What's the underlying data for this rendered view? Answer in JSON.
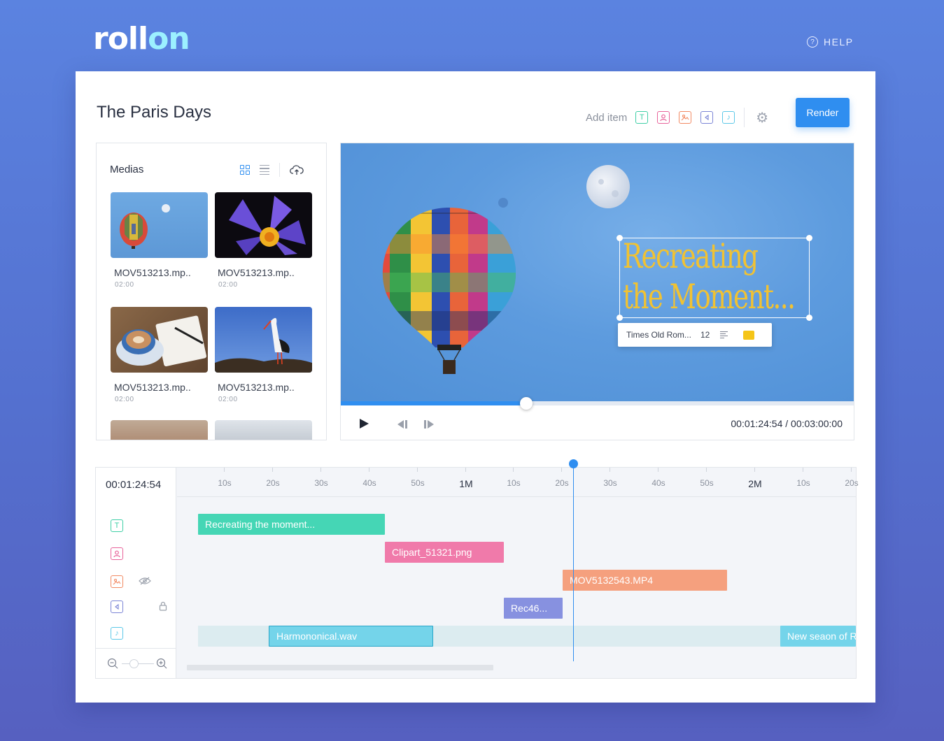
{
  "app": {
    "logo_main": "roll",
    "logo_accent": "on",
    "help_label": "HELP",
    "help_icon": "question-circle-icon"
  },
  "project": {
    "title": "The Paris Days"
  },
  "toolbar": {
    "add_item_label": "Add item",
    "add_items": [
      {
        "icon": "text-icon",
        "glyph": "T"
      },
      {
        "icon": "clipart-icon",
        "glyph": ""
      },
      {
        "icon": "image-icon",
        "glyph": ""
      },
      {
        "icon": "record-icon",
        "glyph": ""
      },
      {
        "icon": "music-icon",
        "glyph": "♪"
      }
    ],
    "settings_icon": "gear-icon",
    "render_label": "Render"
  },
  "medias": {
    "title": "Medias",
    "view_mode": "grid",
    "items": [
      {
        "name": "MOV513213.mp..",
        "duration": "02:00",
        "subject": "balloon"
      },
      {
        "name": "MOV513213.mp..",
        "duration": "02:00",
        "subject": "flower"
      },
      {
        "name": "MOV513213.mp..",
        "duration": "02:00",
        "subject": "coffee"
      },
      {
        "name": "MOV513213.mp..",
        "duration": "02:00",
        "subject": "stork"
      }
    ]
  },
  "preview": {
    "overlay_line1": "Recreating",
    "overlay_line2": "the Moment...",
    "font_name": "Times Old Rom...",
    "font_size": "12",
    "text_color": "#f5c518",
    "progress_fraction": 0.361,
    "current_time": "00:01:24:54",
    "separator": "/",
    "total_time": "00:03:00:00"
  },
  "timeline": {
    "current_time": "00:01:24:54",
    "ticks": [
      {
        "label": "10s",
        "major": false
      },
      {
        "label": "20s",
        "major": false
      },
      {
        "label": "30s",
        "major": false
      },
      {
        "label": "40s",
        "major": false
      },
      {
        "label": "50s",
        "major": false
      },
      {
        "label": "1M",
        "major": true
      },
      {
        "label": "10s",
        "major": false
      },
      {
        "label": "20s",
        "major": false
      },
      {
        "label": "30s",
        "major": false
      },
      {
        "label": "40s",
        "major": false
      },
      {
        "label": "50s",
        "major": false
      },
      {
        "label": "2M",
        "major": true
      },
      {
        "label": "10s",
        "major": false
      },
      {
        "label": "20s",
        "major": false
      }
    ],
    "clips": {
      "text": "Recreating the moment...",
      "clipart": "Clipart_51321.png",
      "video": "MOV5132543.MP4",
      "record": "Rec46...",
      "audio1": "Harmononical.wav",
      "audio2": "New seaon of R"
    },
    "colors": {
      "text": "#45d6b5",
      "clipart": "#f07aaa",
      "video": "#f5a07e",
      "record": "#8791e0",
      "audio": "#74d4ea"
    }
  }
}
